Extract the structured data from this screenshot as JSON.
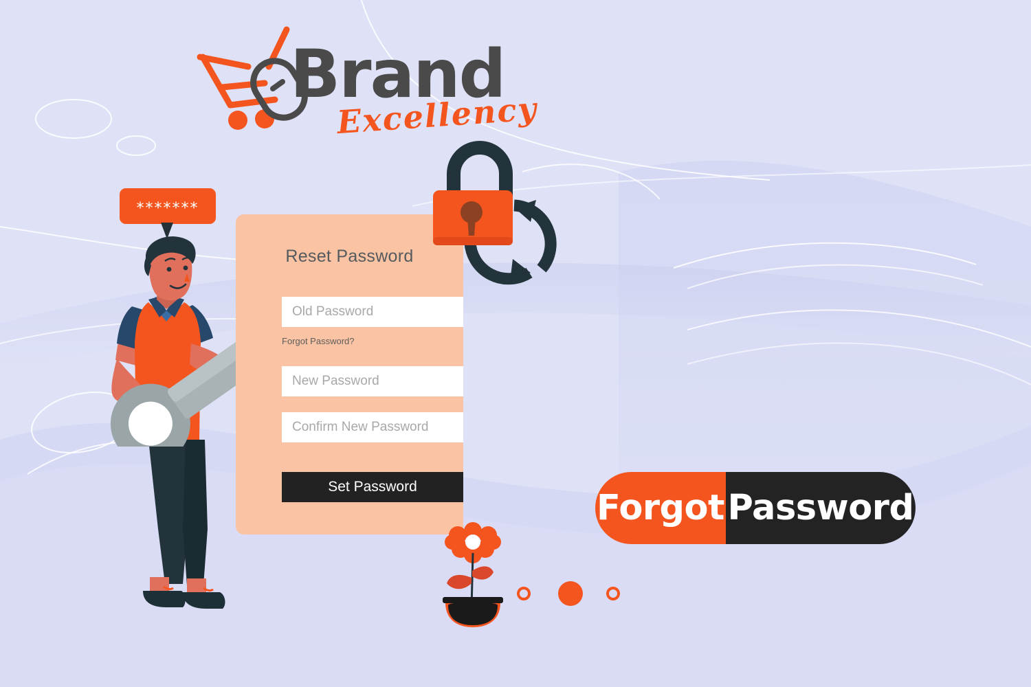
{
  "brand": {
    "name": "Brand",
    "tagline": "Excellency",
    "cart_icon": "shopping-cart-icon",
    "mouse_icon": "computer-mouse-icon"
  },
  "colors": {
    "background": "#dfe2f7",
    "accent_orange": "#f4551e",
    "card_peach": "#fac3a3",
    "dark": "#232323",
    "logo_gray": "#4a4a4a",
    "placeholder_gray": "#a8a8a8"
  },
  "illustration": {
    "speech_bubble_text": "*******",
    "character": "person-holding-key",
    "key_icon": "key-icon",
    "lock_icon": "padlock-reset-icon",
    "flower_icon": "potted-flower-icon"
  },
  "card": {
    "title": "Reset Password",
    "fields": [
      {
        "name": "old-password",
        "placeholder": "Old Password",
        "value": ""
      },
      {
        "name": "new-password",
        "placeholder": "New Password",
        "value": ""
      },
      {
        "name": "confirm-new-password",
        "placeholder": "Confirm New Password",
        "value": ""
      }
    ],
    "forgot_link": "Forgot Password?",
    "submit_label": "Set Password"
  },
  "badge": {
    "left_text": "Forgot",
    "right_text": "Password"
  },
  "carousel": {
    "dots": [
      {
        "state": "inactive"
      },
      {
        "state": "active"
      },
      {
        "state": "inactive"
      }
    ]
  }
}
